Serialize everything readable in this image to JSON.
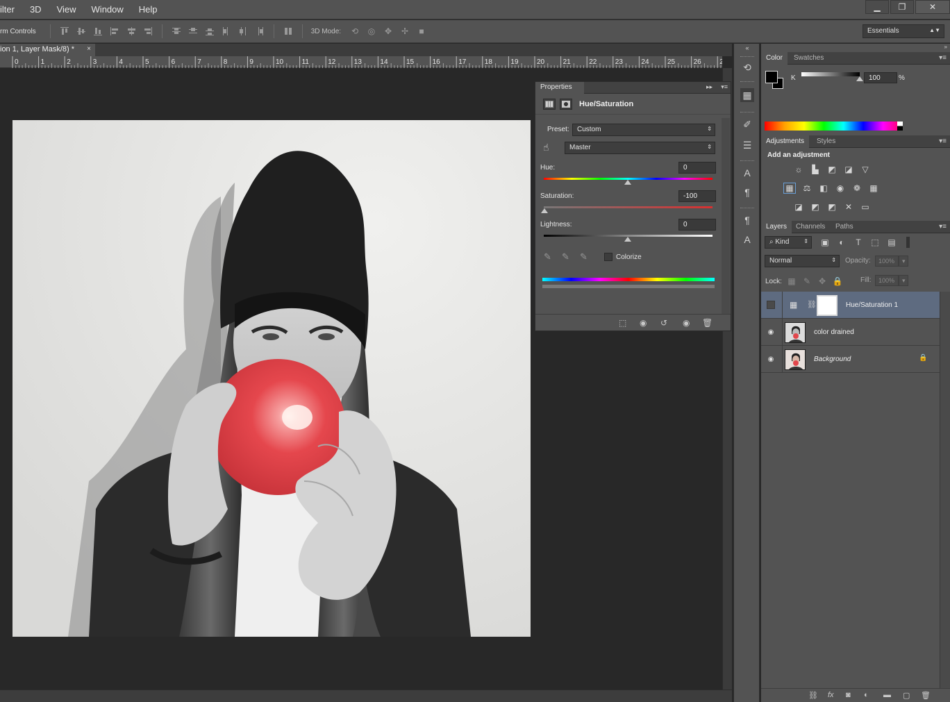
{
  "menu": [
    "ilter",
    "3D",
    "View",
    "Window",
    "Help"
  ],
  "window_controls": {
    "minimize": "▁",
    "restore": "❐",
    "close": "✕"
  },
  "options_bar": {
    "tool_label": "rm Controls",
    "mode_label": "3D Mode:",
    "workspace": "Essentials"
  },
  "document": {
    "tab_title": "ion 1, Layer Mask/8) *",
    "close": "×"
  },
  "ruler": {
    "ticks": [
      "0",
      "1",
      "2",
      "3",
      "4",
      "5",
      "6",
      "7",
      "8",
      "9",
      "10",
      "11",
      "12",
      "13",
      "14",
      "15",
      "16",
      "17",
      "18",
      "19",
      "20",
      "21",
      "22",
      "23",
      "24",
      "25",
      "26",
      "2"
    ]
  },
  "properties": {
    "tab": "Properties",
    "title": "Hue/Saturation",
    "preset_label": "Preset:",
    "preset_value": "Custom",
    "channel_value": "Master",
    "hue_label": "Hue:",
    "hue_value": "0",
    "saturation_label": "Saturation:",
    "saturation_value": "-100",
    "lightness_label": "Lightness:",
    "lightness_value": "0",
    "colorize_label": "Colorize",
    "expand": "▸▸",
    "menu": "▾≡"
  },
  "color_panel": {
    "tabs": [
      "Color",
      "Swatches"
    ],
    "channel_label": "K",
    "k_value": "100",
    "percent": "%"
  },
  "adjustments_panel": {
    "tabs": [
      "Adjustments",
      "Styles"
    ],
    "heading": "Add an adjustment"
  },
  "layers_panel": {
    "tabs": [
      "Layers",
      "Channels",
      "Paths"
    ],
    "filter_kind": "Kind",
    "blend_mode": "Normal",
    "opacity_label": "Opacity:",
    "opacity_value": "100%",
    "lock_label": "Lock:",
    "fill_label": "Fill:",
    "fill_value": "100%",
    "layers": [
      {
        "name": "Hue/Saturation 1",
        "selected": true
      },
      {
        "name": "color drained",
        "selected": false
      },
      {
        "name": "Background",
        "selected": false
      }
    ]
  },
  "colors": {
    "ui_bg": "#535353",
    "canvas_bg": "#282828",
    "selected_layer": "#5e6b80",
    "balloon_red": "#e2464c"
  }
}
